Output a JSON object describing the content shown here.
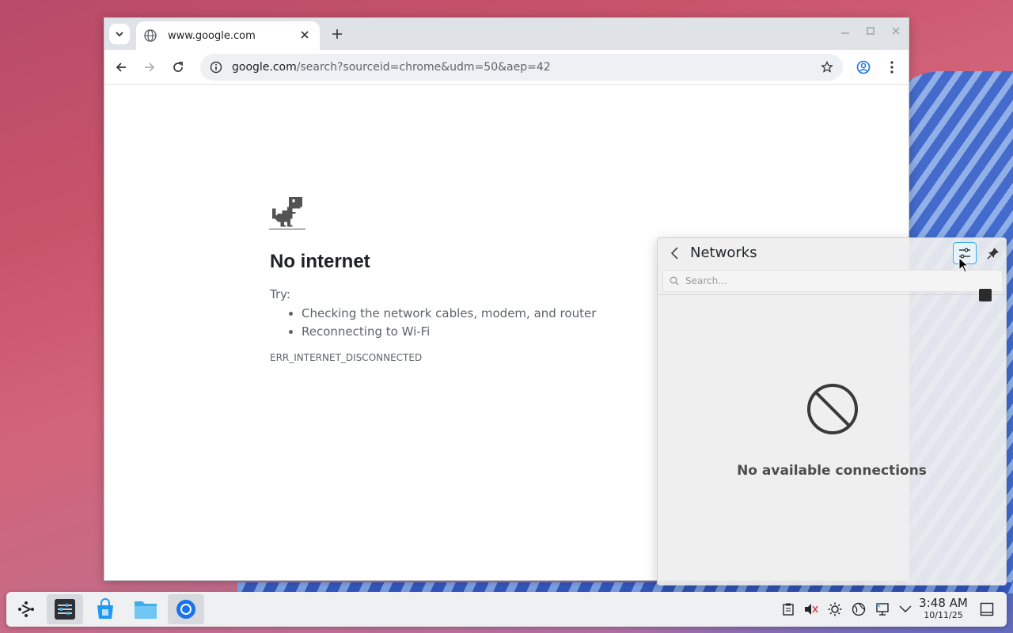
{
  "browser": {
    "tab_title": "www.google.com",
    "url_host": "google.com",
    "url_path": "/search?sourceid=chrome&udm=50&aep=42"
  },
  "error_page": {
    "title": "No internet",
    "try_label": "Try:",
    "suggestions": [
      "Checking the network cables, modem, and router",
      "Reconnecting to Wi-Fi"
    ],
    "error_code": "ERR_INTERNET_DISCONNECTED"
  },
  "networks_popup": {
    "title": "Networks",
    "search_placeholder": "Search...",
    "empty_message": "No available connections"
  },
  "taskbar": {
    "clock_time": "3:48 AM",
    "clock_date": "10/11/25"
  },
  "colors": {
    "accent": "#3daee9",
    "chrome_blue": "#1a73e8"
  }
}
